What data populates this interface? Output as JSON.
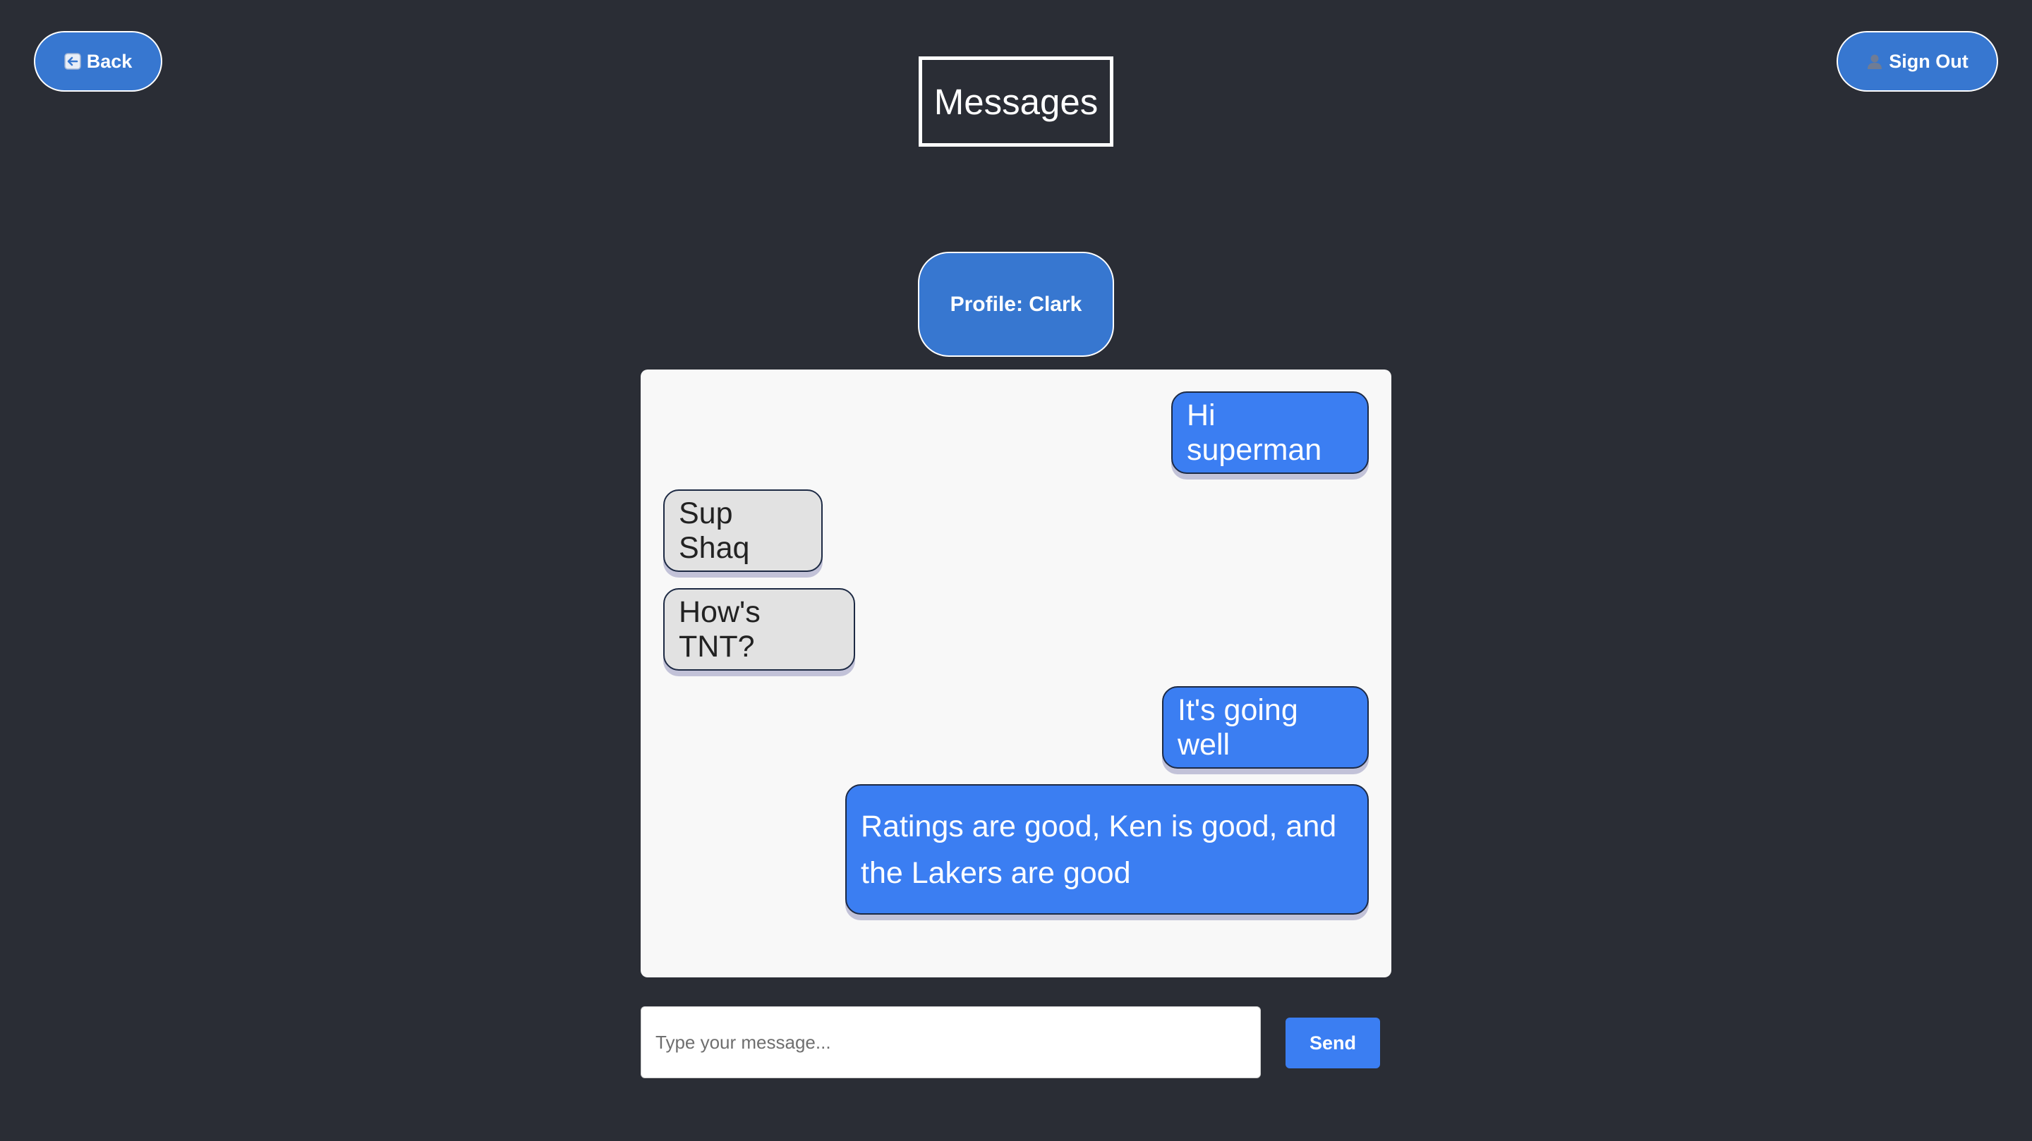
{
  "header": {
    "back_label": "Back",
    "back_icon": "back-arrow-icon",
    "title": "Messages",
    "signout_label": "Sign Out",
    "signout_icon": "user-silhouette-icon"
  },
  "profile": {
    "label": "Profile: Clark"
  },
  "chat": {
    "messages": [
      {
        "sender": "self",
        "text": "Hi superman"
      },
      {
        "sender": "other",
        "text": "Sup Shaq"
      },
      {
        "sender": "other",
        "text": "How's TNT?"
      },
      {
        "sender": "self",
        "text": "It's going well"
      },
      {
        "sender": "self",
        "text": "Ratings are good, Ken is good, and the Lakers are good"
      }
    ]
  },
  "composer": {
    "placeholder": "Type your message...",
    "value": "",
    "send_label": "Send"
  },
  "colors": {
    "background": "#2a2d35",
    "accent_button": "#3777d0",
    "sent_bubble": "#3b7ef2",
    "received_bubble": "#e2e2e2",
    "panel": "#f8f8f8"
  }
}
